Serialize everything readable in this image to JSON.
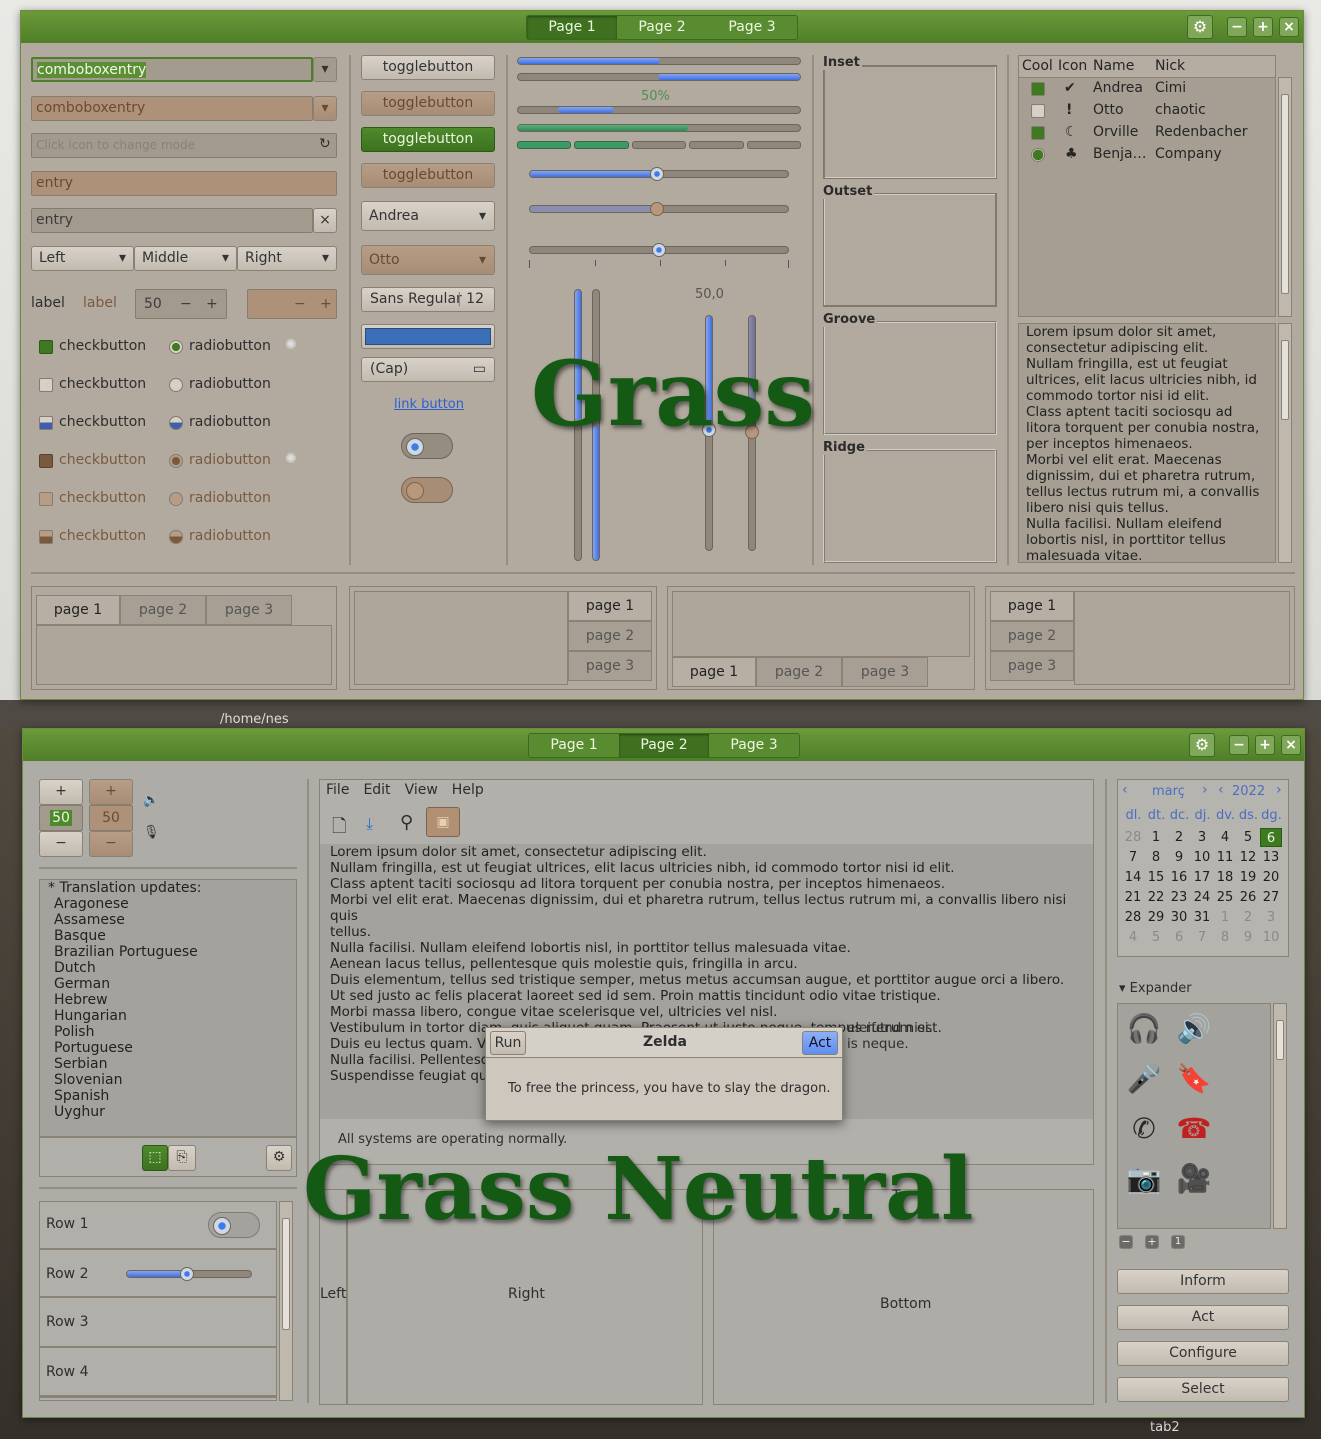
{
  "w1": {
    "stack": [
      "Page 1",
      "Page 2",
      "Page 3"
    ],
    "combo1": "comboboxentry",
    "combo2": "comboboxentry",
    "entry_placeholder": "Click icon to change mode",
    "entry1": "entry",
    "entry2": "entry",
    "seg": [
      "Left",
      "Middle",
      "Right"
    ],
    "label1": "label",
    "label2": "label",
    "spin_value": "50",
    "checkbutton": "checkbutton",
    "radiobutton": "radiobutton",
    "toggle": "togglebutton",
    "combo_andrea": "Andrea",
    "combo_otto": "Otto",
    "font_name": "Sans Regular",
    "font_size": "12",
    "file_cap": "(Cap)",
    "link": "link button",
    "progress_text": "50%",
    "scale_value": "50,0",
    "frames": [
      "Inset",
      "Outset",
      "Groove",
      "Ridge"
    ],
    "tree_headers": [
      "Cool",
      "Icon",
      "Name",
      "Nick"
    ],
    "tree_rows": [
      {
        "name": "Andrea",
        "nick": "Cimi",
        "icon": "✔"
      },
      {
        "name": "Otto",
        "nick": "chaotic",
        "icon": "!"
      },
      {
        "name": "Orville",
        "nick": "Redenbacher",
        "icon": "☾"
      },
      {
        "name": "Benja…",
        "nick": "Company",
        "icon": "♣"
      }
    ],
    "text_lines": [
      "Lorem ipsum dolor sit amet,",
      "consectetur adipiscing elit.",
      "Nullam fringilla, est ut feugiat",
      "ultrices, elit lacus ultricies nibh, id",
      "commodo tortor nisi id elit.",
      "Class aptent taciti sociosqu ad",
      "litora torquent per conubia nostra,",
      "per inceptos himenaeos.",
      "Morbi vel elit erat. Maecenas",
      "dignissim, dui et pharetra rutrum,",
      "tellus lectus rutrum mi, a convallis",
      "libero nisi quis tellus.",
      "Nulla facilisi. Nullam eleifend",
      "lobortis nisl, in porttitor tellus",
      "malesuada vitae."
    ],
    "nb_tabs": [
      "page 1",
      "page 2",
      "page 3"
    ],
    "overlay": "Grass"
  },
  "w2": {
    "stack": [
      "Page 1",
      "Page 2",
      "Page 3"
    ],
    "spin_value": "50",
    "tree_title": "* Translation updates:",
    "languages": [
      "Aragonese",
      "Assamese",
      "Basque",
      "Brazilian Portuguese",
      "Dutch",
      "German",
      "Hebrew",
      "Hungarian",
      "Polish",
      "Portuguese",
      "Serbian",
      "Slovenian",
      "Spanish",
      "Uyghur"
    ],
    "rows": [
      "Row 1",
      "Row 2",
      "Row 3",
      "Row 4"
    ],
    "menu": [
      "File",
      "Edit",
      "View",
      "Help"
    ],
    "text_lines": [
      "Lorem ipsum dolor sit amet, consectetur adipiscing elit.",
      "Nullam fringilla, est ut feugiat ultrices, elit lacus ultricies nibh, id commodo tortor nisi id elit.",
      "Class aptent taciti sociosqu ad litora torquent per conubia nostra, per inceptos himenaeos.",
      "Morbi vel elit erat. Maecenas dignissim, dui et pharetra rutrum, tellus lectus rutrum mi, a convallis libero nisi quis",
      "tellus.",
      "Nulla facilisi. Nullam eleifend lobortis nisl, in porttitor tellus malesuada vitae.",
      "Aenean lacus tellus, pellentesque quis molestie quis, fringilla in arcu.",
      "Duis elementum, tellus sed tristique semper, metus metus accumsan augue, et porttitor augue orci a libero.",
      "Ut sed justo ac felis placerat laoreet sed id sem. Proin mattis tincidunt odio vitae tristique.",
      "Morbi massa libero, congue vitae scelerisque vel, ultricies vel nisl.",
      "Vestibulum in tortor diam, quis aliquet quam. Praesent ut justo neque, tempus rutrum est.",
      "Duis eu lectus quam. Vi",
      "Nulla facilisi. Pellentesq",
      "Suspendisse feugiat qua"
    ],
    "text_tail": [
      "eleifend nisi.",
      "is neque."
    ],
    "status": "All systems are operating normally.",
    "dialog": {
      "run": "Run",
      "title": "Zelda",
      "act": "Act",
      "message": "To free the princess, you have to slay the dragon."
    },
    "paned": {
      "left": "Left",
      "right": "Right",
      "top": "To",
      "bottom": "Bottom"
    },
    "calendar": {
      "month": "març",
      "year": "2022",
      "days": [
        "dl.",
        "dt.",
        "dc.",
        "dj.",
        "dv.",
        "ds.",
        "dg."
      ],
      "weeks": [
        [
          "28",
          "1",
          "2",
          "3",
          "4",
          "5",
          "6"
        ],
        [
          "7",
          "8",
          "9",
          "10",
          "11",
          "12",
          "13"
        ],
        [
          "14",
          "15",
          "16",
          "17",
          "18",
          "19",
          "20"
        ],
        [
          "21",
          "22",
          "23",
          "24",
          "25",
          "26",
          "27"
        ],
        [
          "28",
          "29",
          "30",
          "31",
          "1",
          "2",
          "3"
        ],
        [
          "4",
          "5",
          "6",
          "7",
          "8",
          "9",
          "10"
        ]
      ]
    },
    "expander": "Expander",
    "buttons": [
      "Inform",
      "Act",
      "Configure",
      "Select"
    ],
    "overlay": "Grass Neutral"
  },
  "desktop": {
    "path": "/home/nes",
    "tab2": "tab2"
  }
}
